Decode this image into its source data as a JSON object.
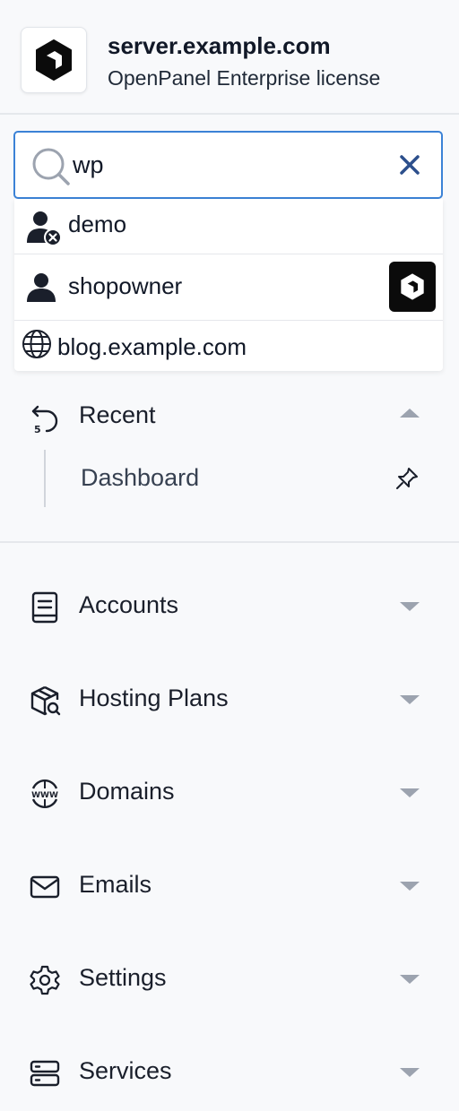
{
  "header": {
    "server_name": "server.example.com",
    "license": "OpenPanel Enterprise license",
    "logo_icon": "openpanel-logo-icon"
  },
  "search": {
    "value": "wp",
    "placeholder": ""
  },
  "results": [
    {
      "label": "demo",
      "icon": "user-suspended-icon"
    },
    {
      "label": "shopowner",
      "icon": "user-icon",
      "badge_icon": "openpanel-logo-icon"
    },
    {
      "label": "blog.example.com",
      "icon": "globe-icon"
    }
  ],
  "recent": {
    "label": "Recent",
    "icon": "history-icon",
    "items": [
      {
        "label": "Dashboard",
        "icon": "pin-icon"
      }
    ]
  },
  "nav": [
    {
      "label": "Accounts",
      "icon": "address-book-icon"
    },
    {
      "label": "Hosting Plans",
      "icon": "package-search-icon"
    },
    {
      "label": "Domains",
      "icon": "www-icon"
    },
    {
      "label": "Emails",
      "icon": "mail-icon"
    },
    {
      "label": "Settings",
      "icon": "gear-icon"
    },
    {
      "label": "Services",
      "icon": "server-icon"
    }
  ],
  "colors": {
    "accent": "#3b82d6",
    "clear_icon": "#2c4f8c",
    "text": "#1a1f2b",
    "background": "#f8f9fb"
  }
}
